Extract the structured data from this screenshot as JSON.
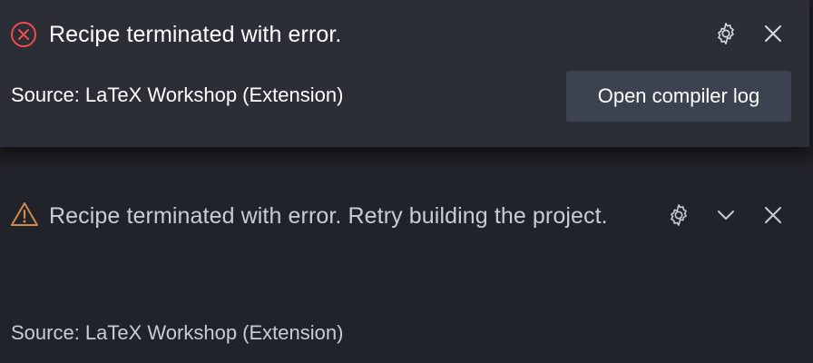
{
  "notifications": [
    {
      "severity": "error",
      "icon": "error-circle-icon",
      "message": "Recipe terminated with error.",
      "source": "Source: LaTeX Workshop (Extension)",
      "action_label": "Open compiler log"
    },
    {
      "severity": "warning",
      "icon": "warning-triangle-icon",
      "message": "Recipe terminated with error. Retry building the project.",
      "source": "Source: LaTeX Workshop (Extension)"
    }
  ],
  "colors": {
    "error": "#f14c4c",
    "warning": "#cca700",
    "toast_bg": "#2b2e37",
    "button_bg": "#3d4250"
  }
}
